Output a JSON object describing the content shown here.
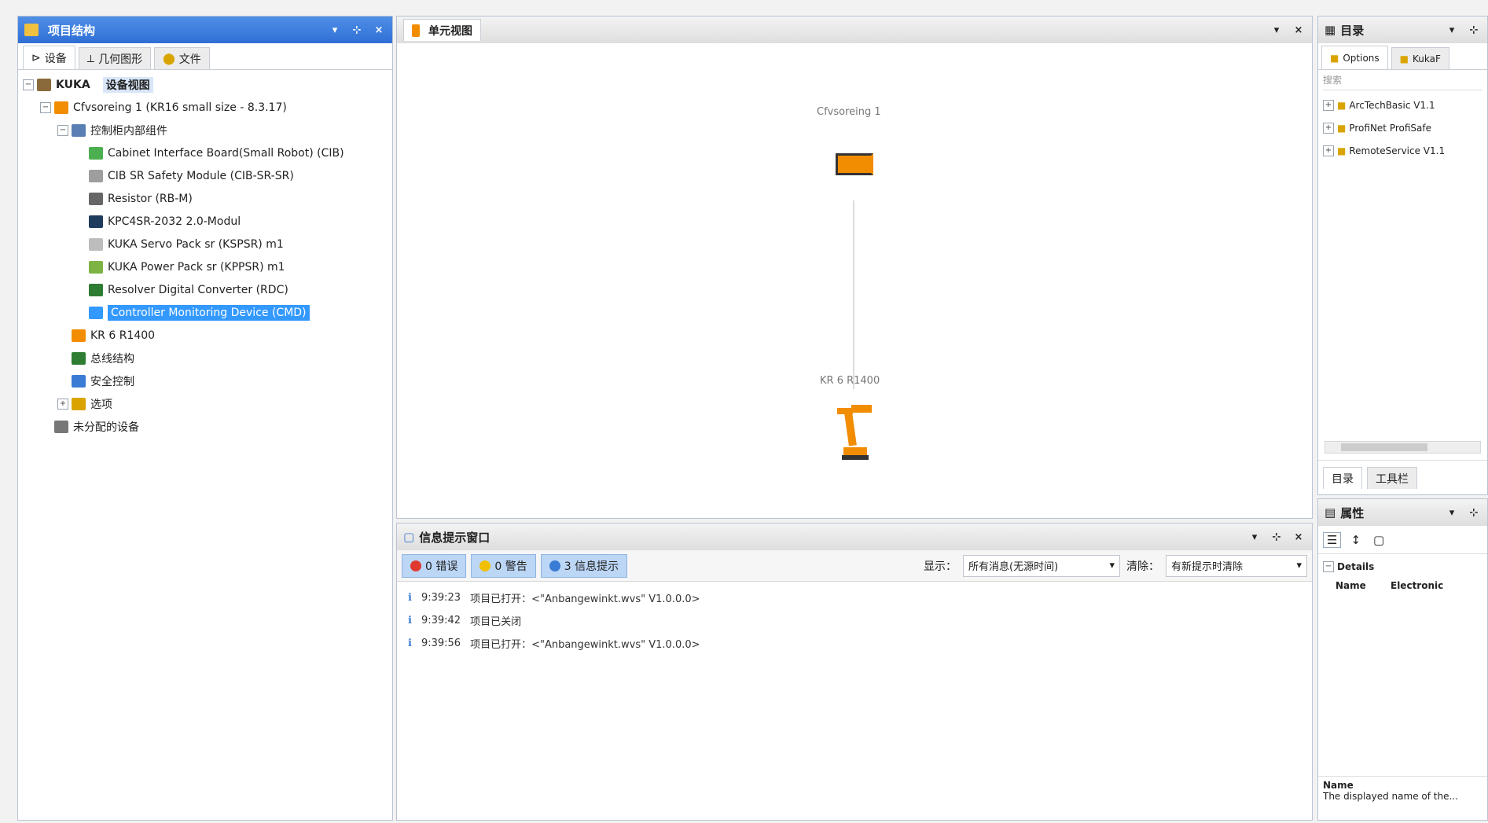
{
  "left_panel": {
    "title": "项目结构",
    "tabs": [
      "设备",
      "几何图形",
      "文件"
    ],
    "tree_root_label": "KUKA",
    "tree_root_tag": "设备视图",
    "tree": [
      {
        "label": "Cfvsoreing 1 (KR16 small size - 8.3.17)",
        "depth": 1,
        "expander": "-"
      },
      {
        "label": "控制柜内部组件",
        "depth": 2,
        "expander": "-"
      },
      {
        "label": "Cabinet Interface Board(Small Robot) (CIB)",
        "depth": 3,
        "expander": ""
      },
      {
        "label": "CIB SR Safety Module (CIB-SR-SR)",
        "depth": 3,
        "expander": ""
      },
      {
        "label": "Resistor (RB-M)",
        "depth": 3,
        "expander": ""
      },
      {
        "label": "KPC4SR-2032 2.0-Modul",
        "depth": 3,
        "expander": ""
      },
      {
        "label": "KUKA Servo Pack sr (KSPSR) m1",
        "depth": 3,
        "expander": ""
      },
      {
        "label": "KUKA Power Pack sr (KPPSR) m1",
        "depth": 3,
        "expander": ""
      },
      {
        "label": "Resolver Digital Converter (RDC)",
        "depth": 3,
        "expander": ""
      },
      {
        "label": "Controller Monitoring Device (CMD)",
        "depth": 3,
        "expander": "",
        "highlight": true
      },
      {
        "label": "KR 6 R1400",
        "depth": 2,
        "expander": ""
      },
      {
        "label": "总线结构",
        "depth": 2,
        "expander": ""
      },
      {
        "label": "安全控制",
        "depth": 2,
        "expander": ""
      },
      {
        "label": "选项",
        "depth": 2,
        "expander": "+"
      },
      {
        "label": "未分配的设备",
        "depth": 1,
        "expander": ""
      }
    ]
  },
  "center": {
    "tab": "单元视图",
    "controller_label": "Cfvsoreing 1",
    "robot_label": "KR 6 R1400"
  },
  "messages": {
    "title": "信息提示窗口",
    "buttons": [
      "0 错误",
      "0 警告",
      "3 信息提示"
    ],
    "filter_label": "显示：",
    "filter_value": "所有消息(无源时间)",
    "clear_label": "清除：",
    "clear_value": "有新提示时清除",
    "lines": [
      {
        "time": "9:39:23",
        "text": "项目已打开：<\"Anbangewinkt.wvs\" V1.0.0.0>"
      },
      {
        "time": "9:39:42",
        "text": "项目已关闭"
      },
      {
        "time": "9:39:56",
        "text": "项目已打开：<\"Anbangewinkt.wvs\" V1.0.0.0>"
      }
    ]
  },
  "right_top": {
    "title": "目录",
    "tabs": [
      "Options",
      "KukaF"
    ],
    "search_placeholder": "搜索",
    "items": [
      "ArcTechBasic V1.1",
      "ProfiNet ProfiSafe",
      "RemoteService V1.1"
    ],
    "bottom_tabs": [
      "目录",
      "工具栏"
    ]
  },
  "right_bottom": {
    "title": "属性",
    "section": "Details",
    "prop_name": "Name",
    "prop_value": "Electronic",
    "desc_title": "Name",
    "desc_text": "The displayed name of the..."
  },
  "colors": {
    "title_active": "#2f6fd6",
    "highlight": "#3399ff",
    "kuka_orange": "#f28c00"
  }
}
